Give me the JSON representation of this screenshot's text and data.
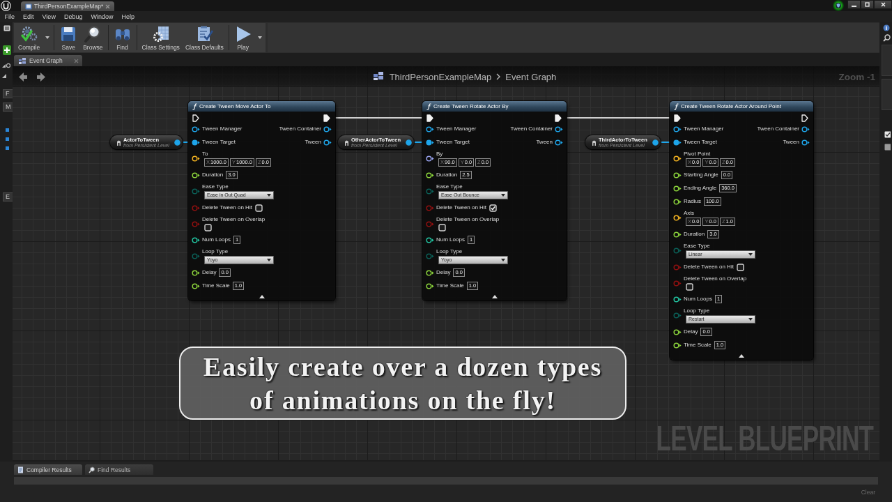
{
  "title_bar": {
    "tabs": [
      {
        "label": "ThirdPersonExampleMap*",
        "selected": true
      }
    ]
  },
  "menu": [
    "File",
    "Edit",
    "View",
    "Debug",
    "Window",
    "Help"
  ],
  "toolbar": {
    "buttons": [
      {
        "kind": "compile",
        "label": "Compile",
        "has_menu": true
      },
      {
        "kind": "save",
        "label": "Save",
        "has_menu": false
      },
      {
        "kind": "browse",
        "label": "Browse",
        "has_menu": false
      },
      {
        "kind": "find",
        "label": "Find",
        "has_menu": false
      },
      {
        "kind": "class_settings",
        "label": "Class Settings",
        "has_menu": false
      },
      {
        "kind": "class_defaults",
        "label": "Class Defaults",
        "has_menu": false
      },
      {
        "kind": "play",
        "label": "Play",
        "has_menu": true
      }
    ]
  },
  "left_panel": {
    "sections": [
      "F",
      "M",
      "E"
    ]
  },
  "right_panel": {
    "checkboxes": [
      {
        "checked": true
      },
      {
        "checked": false
      }
    ]
  },
  "graph_tabs": [
    {
      "label": "Event Graph",
      "selected": true
    }
  ],
  "graph": {
    "breadcrumb": [
      "ThirdPersonExampleMap",
      "Event Graph"
    ],
    "zoom": "Zoom -1",
    "type_label": "LEVEL BLUEPRINT",
    "variables": [
      {
        "name": "ActorToTween",
        "source": "from Persistent Level",
        "connected": true
      },
      {
        "name": "OtherActorToTween",
        "source": "from Persistent Level",
        "connected": true
      },
      {
        "name": "ThirdActorToTween",
        "source": "from Persistent Level",
        "connected": true
      }
    ],
    "nodes": [
      {
        "title": "Create Tween Move Actor To",
        "exec_in_connected": false,
        "exec_out_connected": true,
        "inputs": [
          {
            "kind": "object",
            "label": "Tween Manager",
            "connected": false
          },
          {
            "kind": "object",
            "label": "Tween Target",
            "connected": true
          },
          {
            "kind": "vector",
            "label": "To",
            "connected": false,
            "values": [
              {
                "axis": "X",
                "value": "1000.0"
              },
              {
                "axis": "Y",
                "value": "1000.0"
              },
              {
                "axis": "Z",
                "value": "0.0"
              }
            ]
          },
          {
            "kind": "float",
            "label": "Duration",
            "connected": false,
            "value": "3.0"
          },
          {
            "kind": "enum",
            "label": "Ease Type",
            "connected": false,
            "value": "Ease in Out Quad"
          },
          {
            "kind": "bool",
            "label": "Delete Tween on Hit",
            "connected": false,
            "checked": false
          },
          {
            "kind": "bool_below",
            "label": "Delete Tween on Overlap",
            "connected": false,
            "checked": false
          },
          {
            "kind": "int",
            "label": "Num Loops",
            "connected": false,
            "value": "1"
          },
          {
            "kind": "enum",
            "label": "Loop Type",
            "connected": false,
            "value": "Yoyo"
          },
          {
            "kind": "float",
            "label": "Delay",
            "connected": false,
            "value": "0.0"
          },
          {
            "kind": "float",
            "label": "Time Scale",
            "connected": false,
            "value": "1.0"
          }
        ],
        "outputs": [
          {
            "label": "Tween Container",
            "connected": false
          },
          {
            "label": "Tween",
            "connected": false
          }
        ]
      },
      {
        "title": "Create Tween Rotate Actor By",
        "exec_in_connected": true,
        "exec_out_connected": true,
        "inputs": [
          {
            "kind": "object",
            "label": "Tween Manager",
            "connected": false
          },
          {
            "kind": "object",
            "label": "Tween Target",
            "connected": true
          },
          {
            "kind": "rotator",
            "label": "By",
            "connected": false,
            "values": [
              {
                "axis": "X",
                "value": "90.0"
              },
              {
                "axis": "Y",
                "value": "0.0"
              },
              {
                "axis": "Z",
                "value": "0.0"
              }
            ]
          },
          {
            "kind": "float",
            "label": "Duration",
            "connected": false,
            "value": "2.5"
          },
          {
            "kind": "enum",
            "label": "Ease Type",
            "connected": false,
            "value": "Ease Out Bounce"
          },
          {
            "kind": "bool",
            "label": "Delete Tween on Hit",
            "connected": false,
            "checked": true
          },
          {
            "kind": "bool_below",
            "label": "Delete Tween on Overlap",
            "connected": false,
            "checked": false
          },
          {
            "kind": "int",
            "label": "Num Loops",
            "connected": false,
            "value": "1"
          },
          {
            "kind": "enum",
            "label": "Loop Type",
            "connected": false,
            "value": "Yoyo"
          },
          {
            "kind": "float",
            "label": "Delay",
            "connected": false,
            "value": "0.0"
          },
          {
            "kind": "float",
            "label": "Time Scale",
            "connected": false,
            "value": "1.0"
          }
        ],
        "outputs": [
          {
            "label": "Tween Container",
            "connected": false
          },
          {
            "label": "Tween",
            "connected": false
          }
        ]
      },
      {
        "title": "Create Tween Rotate Actor Around Point",
        "exec_in_connected": true,
        "exec_out_connected": false,
        "inputs": [
          {
            "kind": "object",
            "label": "Tween Manager",
            "connected": false
          },
          {
            "kind": "object",
            "label": "Tween Target",
            "connected": true
          },
          {
            "kind": "vector",
            "label": "Pivot Point",
            "connected": false,
            "values": [
              {
                "axis": "X",
                "value": "0.0"
              },
              {
                "axis": "Y",
                "value": "0.0"
              },
              {
                "axis": "Z",
                "value": "0.0"
              }
            ]
          },
          {
            "kind": "float",
            "label": "Starting Angle",
            "connected": false,
            "value": "0.0"
          },
          {
            "kind": "float",
            "label": "Ending Angle",
            "connected": false,
            "value": "360.0"
          },
          {
            "kind": "float",
            "label": "Radius",
            "connected": false,
            "value": "100.0"
          },
          {
            "kind": "vector",
            "label": "Axis",
            "connected": false,
            "values": [
              {
                "axis": "X",
                "value": "0.0"
              },
              {
                "axis": "Y",
                "value": "0.0"
              },
              {
                "axis": "Z",
                "value": "1.0"
              }
            ]
          },
          {
            "kind": "float",
            "label": "Duration",
            "connected": false,
            "value": "3.0"
          },
          {
            "kind": "enum",
            "label": "Ease Type",
            "connected": false,
            "value": "Linear"
          },
          {
            "kind": "bool",
            "label": "Delete Tween on Hit",
            "connected": false,
            "checked": false
          },
          {
            "kind": "bool_below",
            "label": "Delete Tween on Overlap",
            "connected": false,
            "checked": false
          },
          {
            "kind": "int",
            "label": "Num Loops",
            "connected": false,
            "value": "1"
          },
          {
            "kind": "enum",
            "label": "Loop Type",
            "connected": false,
            "value": "Restart"
          },
          {
            "kind": "float",
            "label": "Delay",
            "connected": false,
            "value": "0.0"
          },
          {
            "kind": "float",
            "label": "Time Scale",
            "connected": false,
            "value": "1.0"
          }
        ],
        "outputs": [
          {
            "label": "Tween Container",
            "connected": false
          },
          {
            "label": "Tween",
            "connected": false
          }
        ]
      }
    ],
    "caption": "Easily create over a dozen types of animations on the fly!"
  },
  "bottom_panel": {
    "tabs": [
      {
        "label": "Compiler Results",
        "selected": true
      },
      {
        "label": "Find Results",
        "selected": false
      }
    ],
    "clear_button": {
      "label": "Clear",
      "disabled": true
    }
  }
}
